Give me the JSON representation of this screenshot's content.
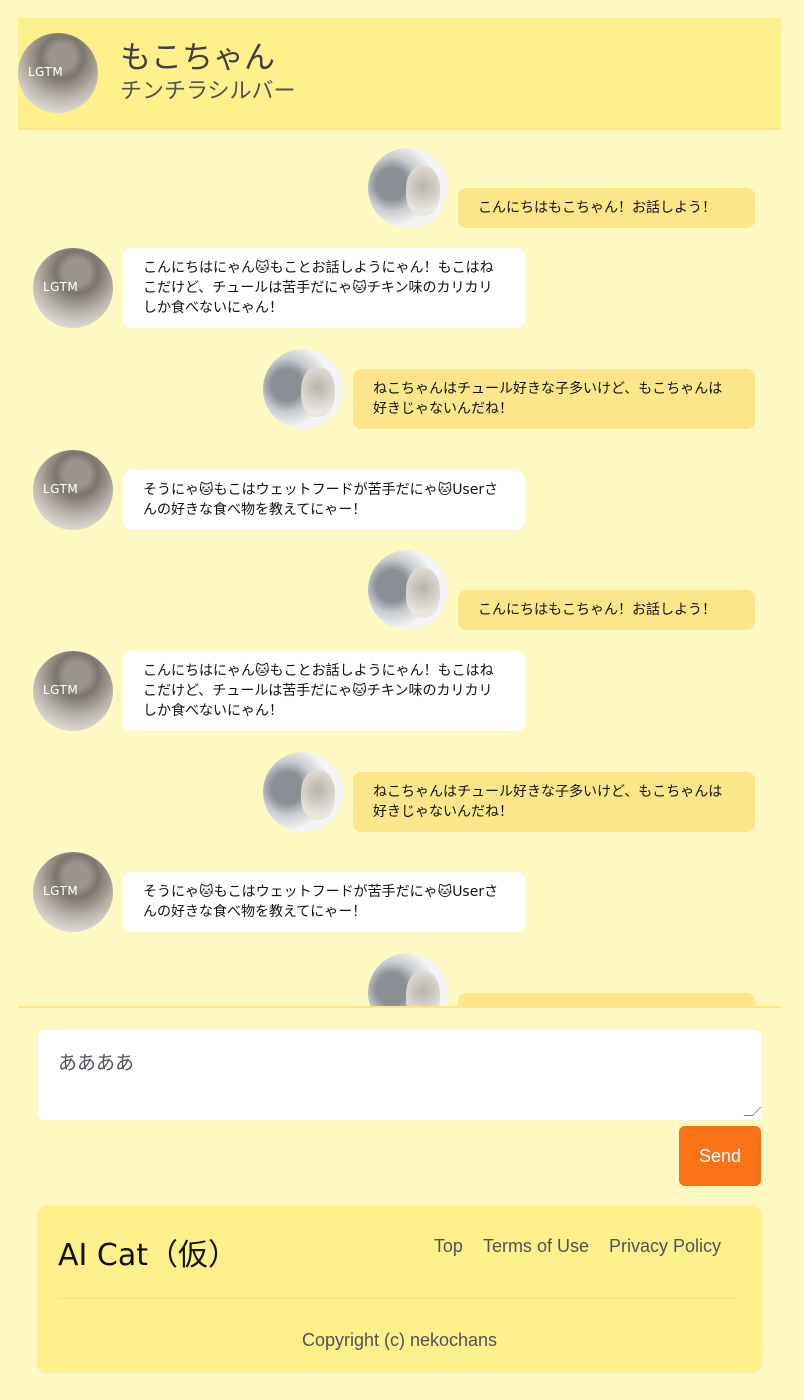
{
  "header": {
    "name": "もこちゃん",
    "breed": "チンチラシルバー",
    "avatar_text": "LGTM"
  },
  "messages": [
    {
      "sender": "user",
      "text": "こんにちはもこちゃん！お話しよう！"
    },
    {
      "sender": "cat",
      "text": "こんにちはにゃん🐱もことお話しようにゃん！もこはねこだけど、チュールは苦手だにゃ🐱チキン味のカリカリしか食べないにゃん！"
    },
    {
      "sender": "user",
      "text": "ねこちゃんはチュール好きな子多いけど、もこちゃんは好きじゃないんだね！"
    },
    {
      "sender": "cat",
      "text": "そうにゃ🐱もこはウェットフードが苦手だにゃ🐱Userさんの好きな食べ物を教えてにゃー！"
    },
    {
      "sender": "user",
      "text": "こんにちはもこちゃん！お話しよう！"
    },
    {
      "sender": "cat",
      "text": "こんにちはにゃん🐱もことお話しようにゃん！もこはねこだけど、チュールは苦手だにゃ🐱チキン味のカリカリしか食べないにゃん！"
    },
    {
      "sender": "user",
      "text": "ねこちゃんはチュール好きな子多いけど、もこちゃんは好きじゃないんだね！"
    },
    {
      "sender": "cat",
      "text": "そうにゃ🐱もこはウェットフードが苦手だにゃ🐱Userさんの好きな食べ物を教えてにゃー！"
    },
    {
      "sender": "user",
      "text": ""
    }
  ],
  "input": {
    "value": "ああああ"
  },
  "send_label": "Send",
  "footer": {
    "brand": "AI Cat（仮）",
    "links": [
      "Top",
      "Terms of Use",
      "Privacy Policy"
    ],
    "copyright": "Copyright (c) nekochans"
  },
  "colors": {
    "page_bg": "#fef9c3",
    "header_bg": "#fef08a",
    "user_bubble": "#fde68a",
    "bot_bubble": "#ffffff",
    "send_button": "#f97316"
  }
}
